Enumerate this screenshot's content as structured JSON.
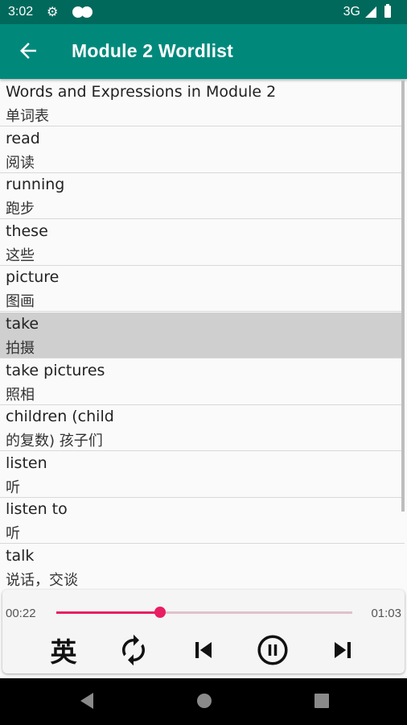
{
  "status_bar": {
    "time": "3:02",
    "network": "3G"
  },
  "app_bar": {
    "title": "Module 2  Wordlist"
  },
  "words": [
    {
      "en": "Words and Expressions in Module 2",
      "zh": "单词表",
      "selected": false
    },
    {
      "en": "read",
      "zh": "阅读",
      "selected": false
    },
    {
      "en": "running",
      "zh": "跑步",
      "selected": false
    },
    {
      "en": "these",
      "zh": "这些",
      "selected": false
    },
    {
      "en": "picture",
      "zh": "图画",
      "selected": false
    },
    {
      "en": "take",
      "zh": "拍摄",
      "selected": true
    },
    {
      "en": "take pictures",
      "zh": "照相",
      "selected": false
    },
    {
      "en": "children  (child",
      "zh": "的复数) 孩子们",
      "selected": false
    },
    {
      "en": "listen",
      "zh": "听",
      "selected": false
    },
    {
      "en": "listen to",
      "zh": "听",
      "selected": false
    },
    {
      "en": "talk",
      "zh": "说话，交谈",
      "selected": false
    }
  ],
  "player": {
    "elapsed": "00:22",
    "total": "01:03",
    "progress": 0.35,
    "language_label": "英"
  },
  "icons": {
    "back": "arrow-left-icon",
    "repeat": "repeat-icon",
    "previous": "skip-previous-icon",
    "pause": "pause-icon",
    "next": "skip-next-icon"
  },
  "colors": {
    "primary": "#00897b",
    "primary_dark": "#00695c",
    "accent": "#e91e63",
    "selected_row": "#cfcfcf"
  }
}
